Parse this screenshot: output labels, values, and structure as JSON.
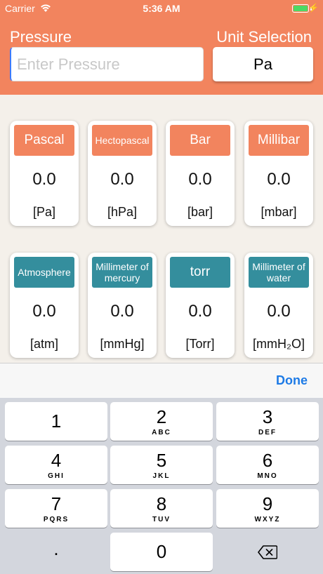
{
  "status_bar": {
    "carrier": "Carrier",
    "time": "5:36 AM",
    "wifi_icon": "wifi-icon",
    "battery_icon": "battery-icon",
    "charging_icon": "charging-bolt-icon"
  },
  "header": {
    "pressure_label": "Pressure",
    "unit_selection_label": "Unit Selection",
    "input_placeholder": "Enter Pressure",
    "input_value": "",
    "selected_unit": "Pa"
  },
  "cards": [
    {
      "title": "Pascal",
      "value": "0.0",
      "unit": "[Pa]",
      "color": "#f2845e"
    },
    {
      "title": "Hectopascal",
      "value": "0.0",
      "unit": "[hPa]",
      "color": "#f2845e"
    },
    {
      "title": "Bar",
      "value": "0.0",
      "unit": "[bar]",
      "color": "#f2845e"
    },
    {
      "title": "Millibar",
      "value": "0.0",
      "unit": "[mbar]",
      "color": "#f2845e"
    },
    {
      "title": "Atmosphere",
      "value": "0.0",
      "unit": "[atm]",
      "color": "#348e9d"
    },
    {
      "title": "Millimeter of mercury",
      "value": "0.0",
      "unit": "[mmHg]",
      "color": "#348e9d"
    },
    {
      "title": "torr",
      "value": "0.0",
      "unit": "[Torr]",
      "color": "#348e9d"
    },
    {
      "title": "Millimeter of water",
      "value": "0.0",
      "unit": "[mmH₂O]",
      "color": "#348e9d"
    }
  ],
  "toolbar": {
    "done_label": "Done"
  },
  "keypad": [
    {
      "num": "1",
      "letters": ""
    },
    {
      "num": "2",
      "letters": "ABC"
    },
    {
      "num": "3",
      "letters": "DEF"
    },
    {
      "num": "4",
      "letters": "GHI"
    },
    {
      "num": "5",
      "letters": "JKL"
    },
    {
      "num": "6",
      "letters": "MNO"
    },
    {
      "num": "7",
      "letters": "PQRS"
    },
    {
      "num": "8",
      "letters": "TUV"
    },
    {
      "num": "9",
      "letters": "WXYZ"
    },
    {
      "num": ".",
      "letters": ""
    },
    {
      "num": "0",
      "letters": ""
    },
    {
      "num": "",
      "letters": "",
      "icon": "backspace-icon"
    }
  ],
  "colors": {
    "accent": "#f2845e",
    "secondary": "#348e9d",
    "done": "#1d7ae6"
  }
}
